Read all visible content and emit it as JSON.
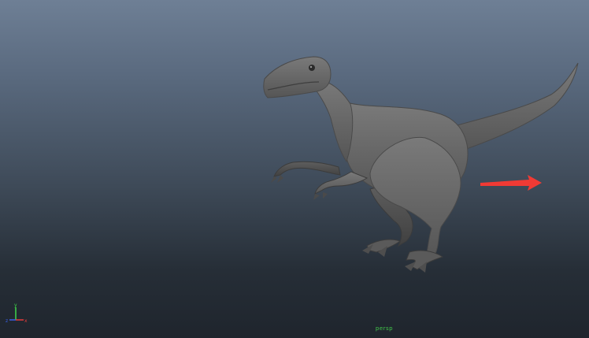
{
  "viewport": {
    "background_top": "#6e7f95",
    "background_bottom": "#1f252d",
    "model_color": "#6a6a6a",
    "camera_label": "persp"
  },
  "model": {
    "name": "velociraptor"
  },
  "annotation": {
    "arrow_color": "#f03a34",
    "direction": "right"
  },
  "axis_gizmo": {
    "x_label": "x",
    "y_label": "y",
    "z_label": "z",
    "x_color": "#e23b3b",
    "y_color": "#3fd64a",
    "z_color": "#3a5fe8"
  }
}
